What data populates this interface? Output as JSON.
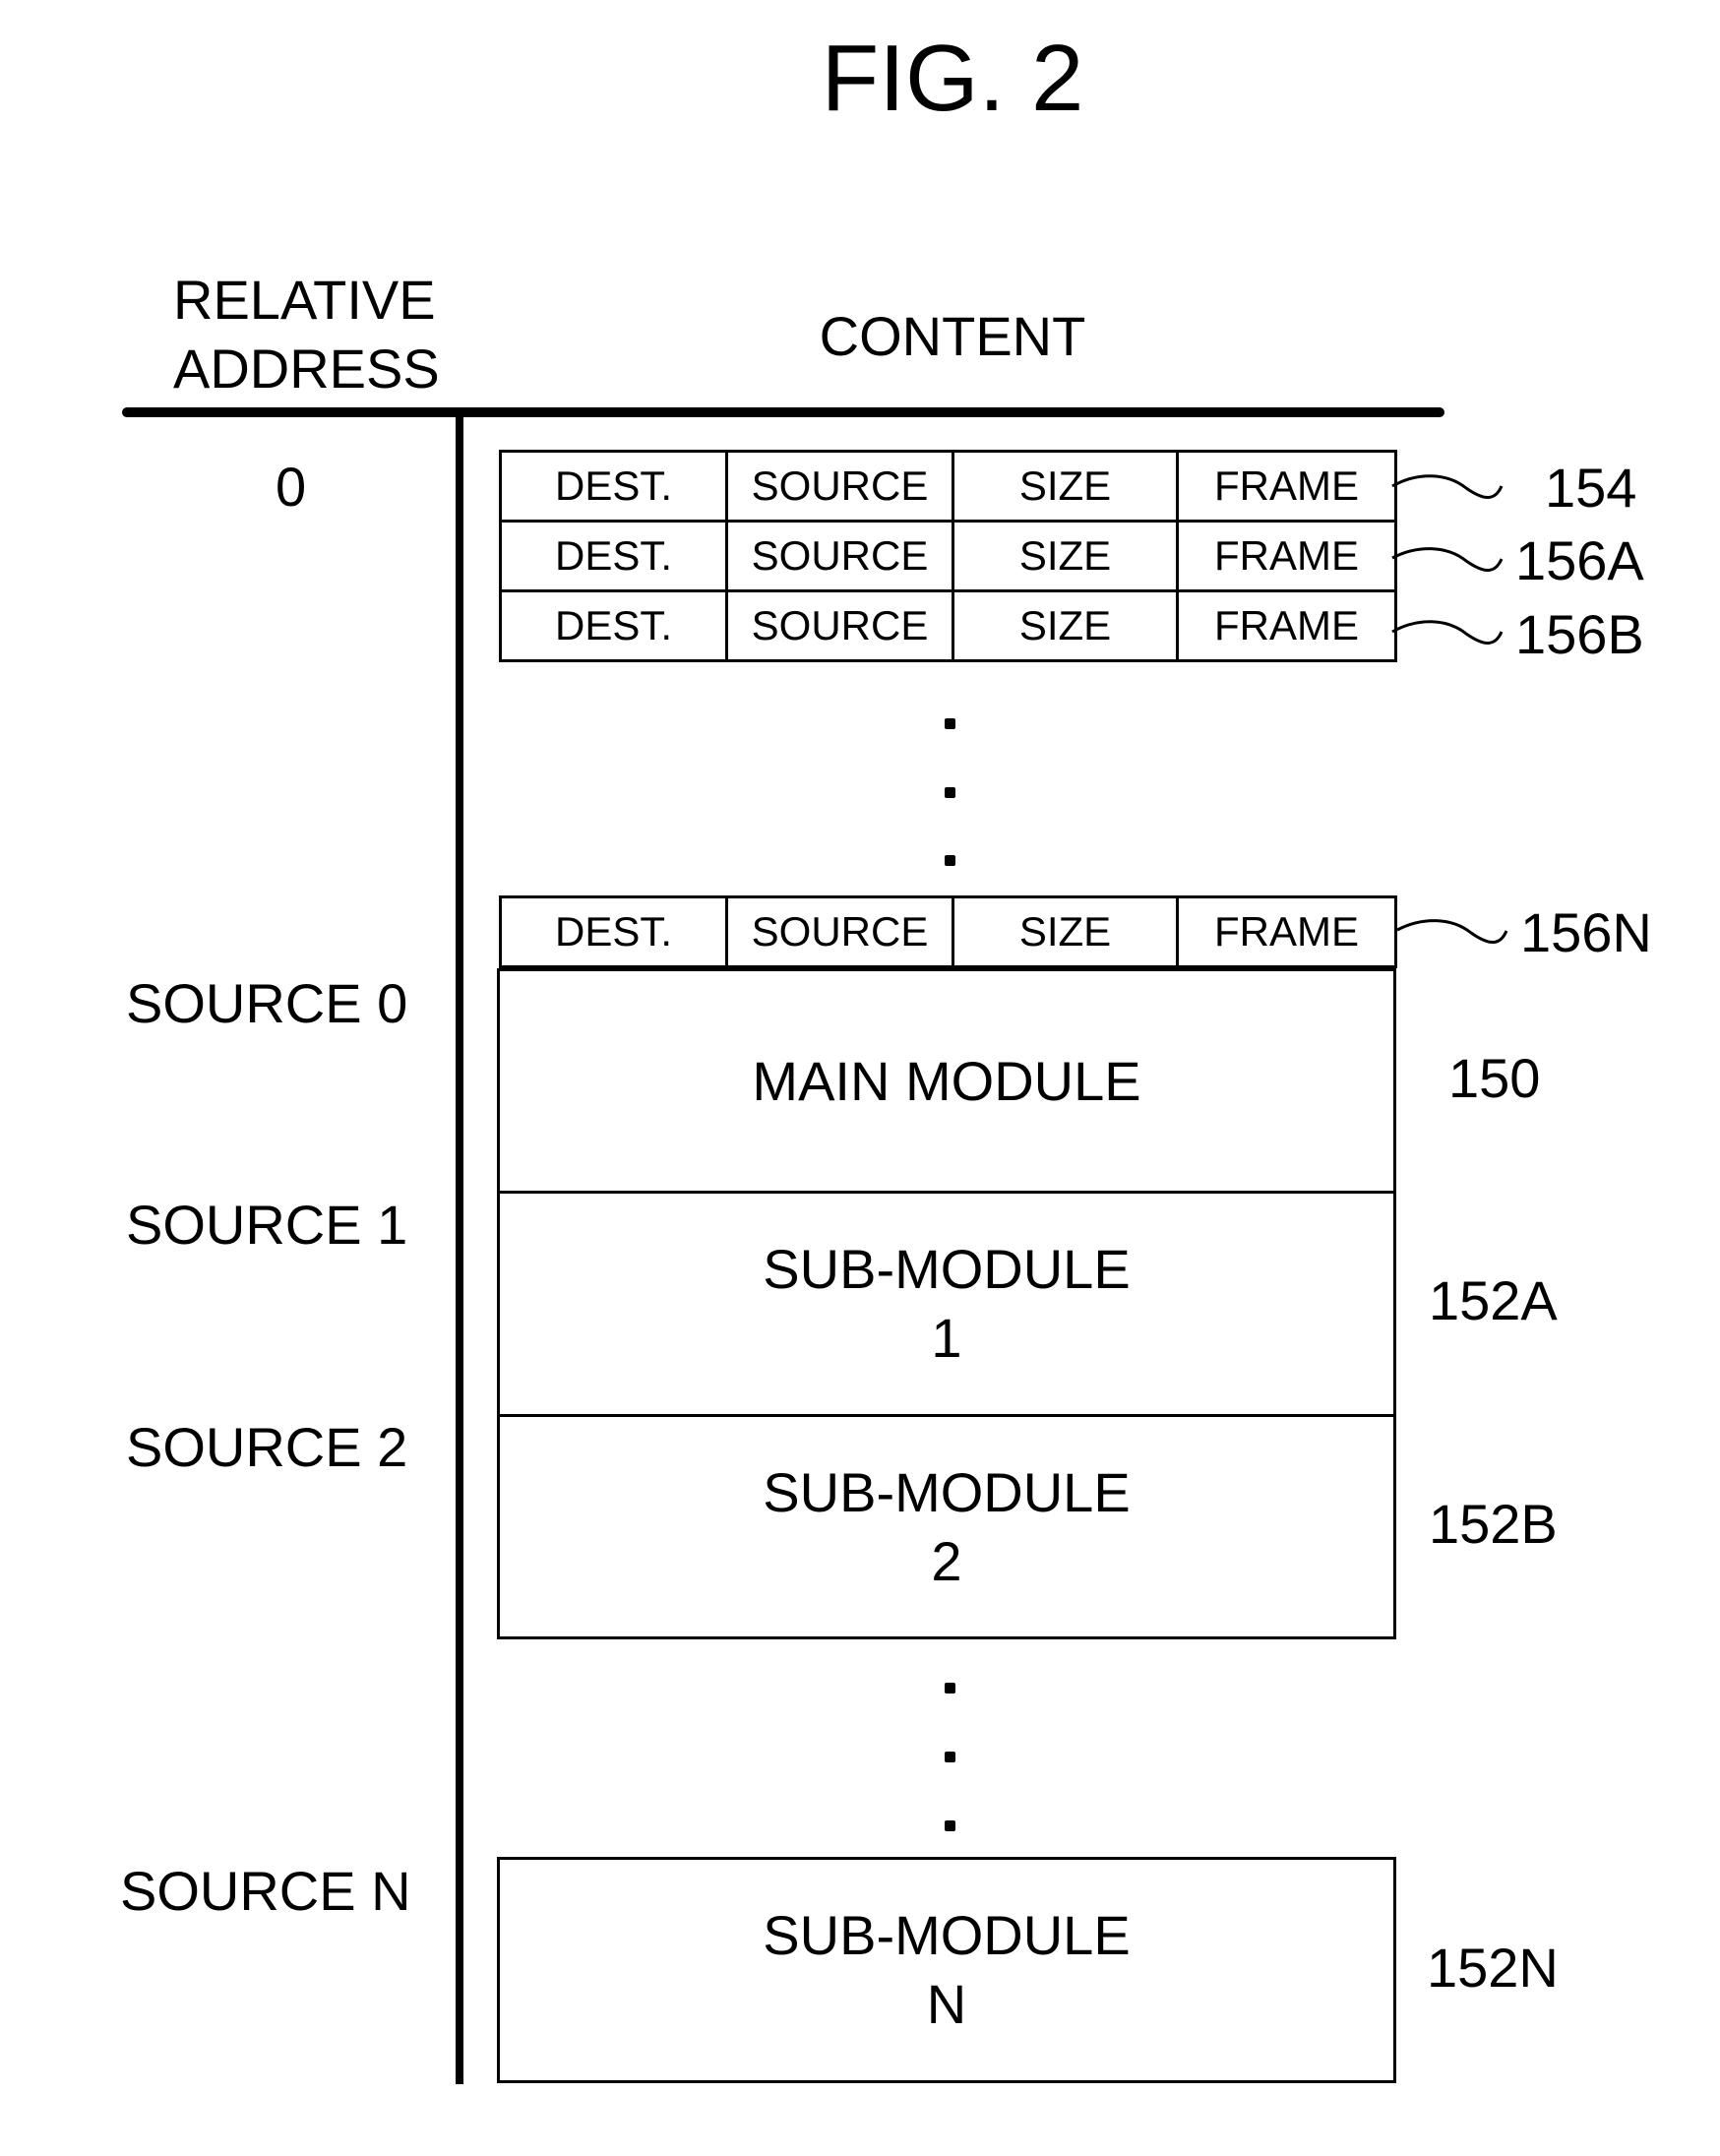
{
  "figure": {
    "title": "FIG. 2"
  },
  "headers": {
    "address": [
      "RELATIVE",
      "ADDRESS"
    ],
    "content": "CONTENT"
  },
  "entry_columns": [
    "DEST.",
    "SOURCE",
    "SIZE",
    "FRAME"
  ],
  "entries": [
    {
      "cells": [
        "DEST.",
        "SOURCE",
        "SIZE",
        "FRAME"
      ],
      "ref": "154"
    },
    {
      "cells": [
        "DEST.",
        "SOURCE",
        "SIZE",
        "FRAME"
      ],
      "ref": "156A"
    },
    {
      "cells": [
        "DEST.",
        "SOURCE",
        "SIZE",
        "FRAME"
      ],
      "ref": "156B"
    },
    {
      "cells": [
        "DEST.",
        "SOURCE",
        "SIZE",
        "FRAME"
      ],
      "ref": "156N"
    }
  ],
  "addresses": {
    "first": "0",
    "source0": "SOURCE 0",
    "source1": "SOURCE 1",
    "source2": "SOURCE 2",
    "sourceN": "SOURCE N"
  },
  "modules": [
    {
      "lines": [
        "MAIN MODULE"
      ],
      "ref": "150"
    },
    {
      "lines": [
        "SUB-MODULE",
        "1"
      ],
      "ref": "152A"
    },
    {
      "lines": [
        "SUB-MODULE",
        "2"
      ],
      "ref": "152B"
    },
    {
      "lines": [
        "SUB-MODULE",
        "N"
      ],
      "ref": "152N"
    }
  ]
}
